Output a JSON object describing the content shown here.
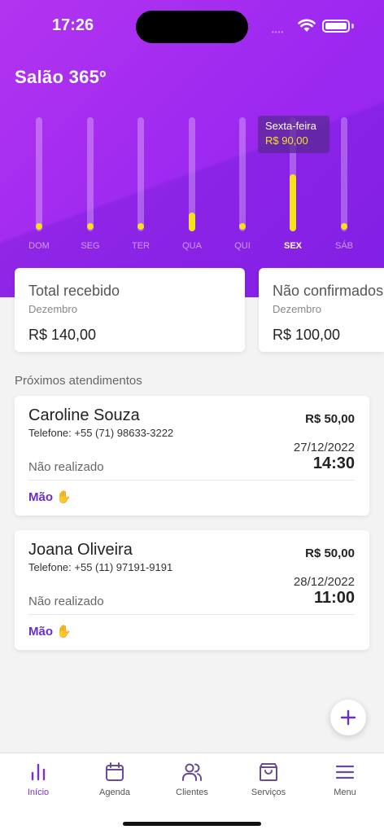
{
  "status_bar": {
    "time": "17:26",
    "signal_dots": "••••"
  },
  "app": {
    "title": "Salão 365º"
  },
  "chart_data": {
    "type": "bar",
    "categories": [
      "DOM",
      "SEG",
      "TER",
      "QUA",
      "QUI",
      "SEX",
      "SÁB"
    ],
    "values": [
      0,
      0,
      0,
      30,
      0,
      90,
      0
    ],
    "ylim": [
      0,
      180
    ],
    "active_category": "SEX",
    "tooltip": {
      "label": "Sexta-feira",
      "value": "R$ 90,00"
    },
    "colors": {
      "fill": "#f5e11c",
      "track": "rgba(255,255,255,0.28)"
    }
  },
  "summary": [
    {
      "title": "Total recebido",
      "subtitle": "Dezembro",
      "value": "R$ 140,00"
    },
    {
      "title": "Não confirmados",
      "subtitle": "Dezembro",
      "value": "R$ 100,00"
    }
  ],
  "upcoming": {
    "title": "Próximos atendimentos",
    "items": [
      {
        "name": "Caroline Souza",
        "phone": "Telefone: +55 (71) 98633-3222",
        "price": "R$ 50,00",
        "date": "27/12/2022",
        "time": "14:30",
        "status": "Não realizado",
        "service": "Mão ✋"
      },
      {
        "name": "Joana Oliveira",
        "phone": "Telefone: +55 (11) 97191-9191",
        "price": "R$ 50,00",
        "date": "28/12/2022",
        "time": "11:00",
        "status": "Não realizado",
        "service": "Mão ✋"
      }
    ]
  },
  "fab": {
    "icon": "plus-icon"
  },
  "tabbar": {
    "items": [
      {
        "label": "Início",
        "icon": "bar-chart-icon",
        "active": true
      },
      {
        "label": "Agenda",
        "icon": "calendar-icon"
      },
      {
        "label": "Clientes",
        "icon": "users-icon"
      },
      {
        "label": "Serviços",
        "icon": "shopping-bag-icon"
      },
      {
        "label": "Menu",
        "icon": "menu-icon"
      }
    ]
  },
  "colors": {
    "accent": "#7b30d6",
    "hero_gradient_start": "#b334f0",
    "hero_gradient_end": "#8f23ef",
    "highlight": "#f5e11c"
  }
}
